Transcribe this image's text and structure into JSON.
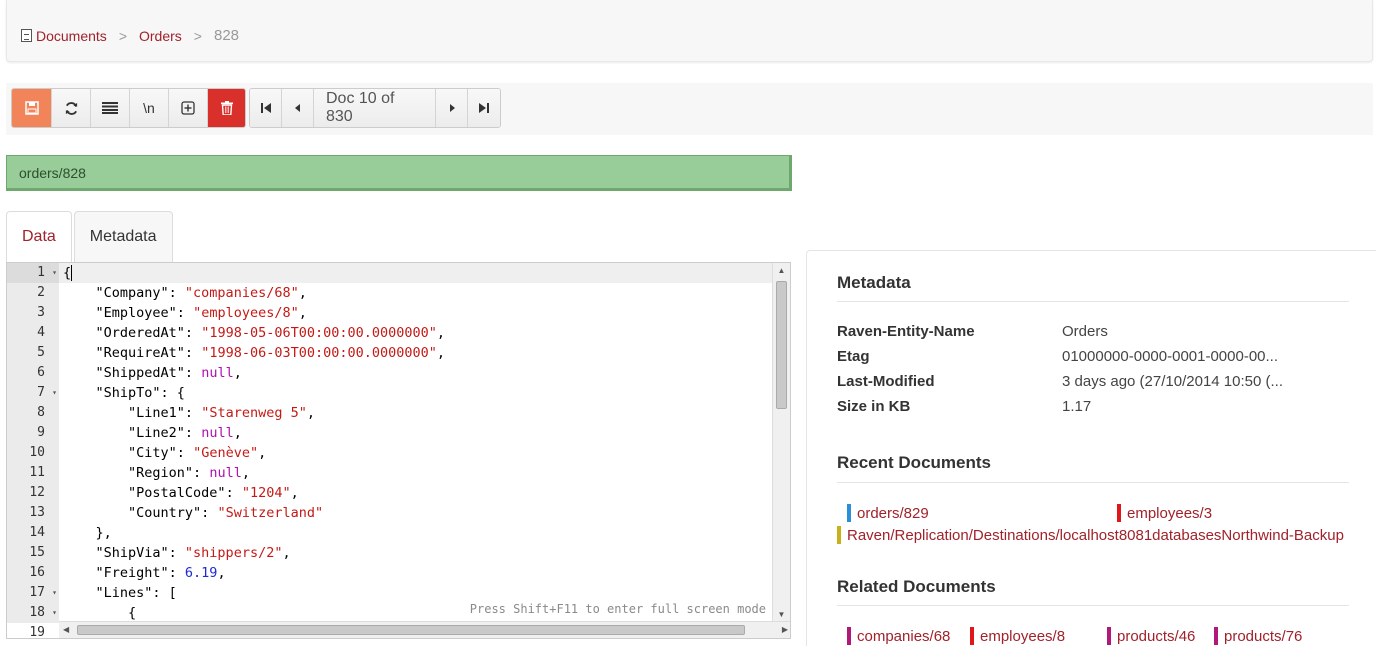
{
  "breadcrumb": {
    "root": "Documents",
    "collection": "Orders",
    "current": "828",
    "separator": ">"
  },
  "toolbar": {
    "save_icon": "save-icon",
    "refresh_icon": "refresh-icon",
    "format_icon": "list-icon",
    "newline_label": "\\n",
    "expand_icon": "plus-square-icon",
    "delete_icon": "trash-icon",
    "pager_label": "Doc 10 of 830",
    "colors": {
      "save": "#f2845a",
      "delete": "#d9302c"
    }
  },
  "document_id": "orders/828",
  "tabs": [
    {
      "label": "Data"
    },
    {
      "label": "Metadata"
    }
  ],
  "editor": {
    "line_numbers": [
      "1",
      "2",
      "3",
      "4",
      "5",
      "6",
      "7",
      "8",
      "9",
      "10",
      "11",
      "12",
      "13",
      "14",
      "15",
      "16",
      "17",
      "18",
      "19"
    ],
    "hint": "Press Shift+F11 to enter full screen mode"
  },
  "metadata": {
    "heading": "Metadata",
    "rows": [
      {
        "key": "Raven-Entity-Name",
        "value": "Orders"
      },
      {
        "key": "Etag",
        "value": "01000000-0000-0001-0000-00..."
      },
      {
        "key": "Last-Modified",
        "value": "3 days ago (27/10/2014 10:50 (..."
      },
      {
        "key": "Size in KB",
        "value": "1.17"
      }
    ]
  },
  "recent": {
    "heading": "Recent Documents",
    "items": [
      {
        "label": "orders/829",
        "color": "#2a8fd6"
      },
      {
        "label": "employees/3",
        "color": "#e0161b"
      },
      {
        "label": "Raven/Replication/Destinations/localhost8081databasesNorthwind-Backup",
        "color": "#c9b11a"
      }
    ]
  },
  "related": {
    "heading": "Related Documents",
    "items": [
      {
        "label": "companies/68",
        "color": "#b0187a"
      },
      {
        "label": "employees/8",
        "color": "#e0161b"
      },
      {
        "label": "products/46",
        "color": "#b0187a"
      },
      {
        "label": "products/76",
        "color": "#b0187a"
      }
    ]
  },
  "json_doc": {
    "Company": "\"companies/68\"",
    "Employee": "\"employees/8\"",
    "OrderedAt": "\"1998-05-06T00:00:00.0000000\"",
    "RequireAt": "\"1998-06-03T00:00:00.0000000\"",
    "ShippedAt": "null",
    "Line1": "\"Starenweg 5\"",
    "Line2": "null",
    "City": "\"Genève\"",
    "Region": "null",
    "PostalCode": "\"1204\"",
    "Country": "\"Switzerland\"",
    "ShipVia": "\"shippers/2\"",
    "Freight": "6.19"
  }
}
